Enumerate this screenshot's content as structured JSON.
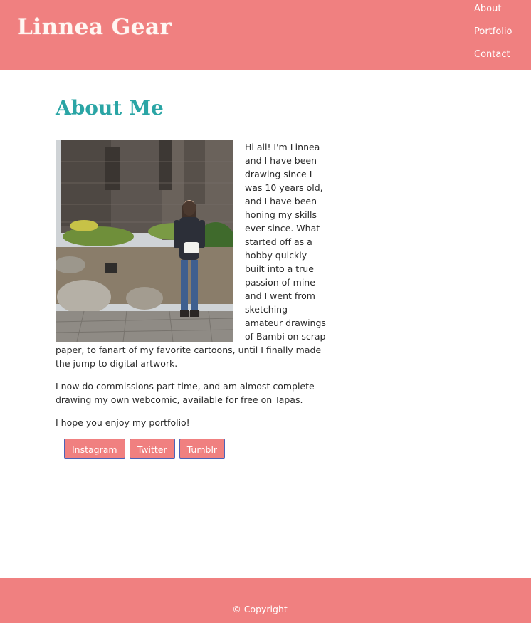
{
  "header": {
    "brand": "Linnea Gear",
    "nav": [
      {
        "label": "About"
      },
      {
        "label": "Portfolio"
      },
      {
        "label": "Contact"
      }
    ]
  },
  "main": {
    "title": "About Me",
    "paragraphs": [
      "Hi all! I'm Linnea and I have been drawing since I was 10 years old, and I have been honing my skills ever since. What started off as a hobby quickly built into a true passion of mine and I went from sketching amateur drawings of Bambi on scrap paper, to fanart of my favorite cartoons, until I finally made the jump to digital artwork.",
      "I now do commissions part time, and am almost complete drawing my own webcomic, available for free on Tapas.",
      "I hope you enjoy my portfolio!"
    ],
    "social_buttons": [
      {
        "label": "Instagram"
      },
      {
        "label": "Twitter"
      },
      {
        "label": "Tumblr"
      }
    ]
  },
  "footer": {
    "copyright": "© Copyright"
  },
  "colors": {
    "brand_bar": "#f08080",
    "title": "#2aa5a5",
    "button_border": "#4a62b8"
  }
}
